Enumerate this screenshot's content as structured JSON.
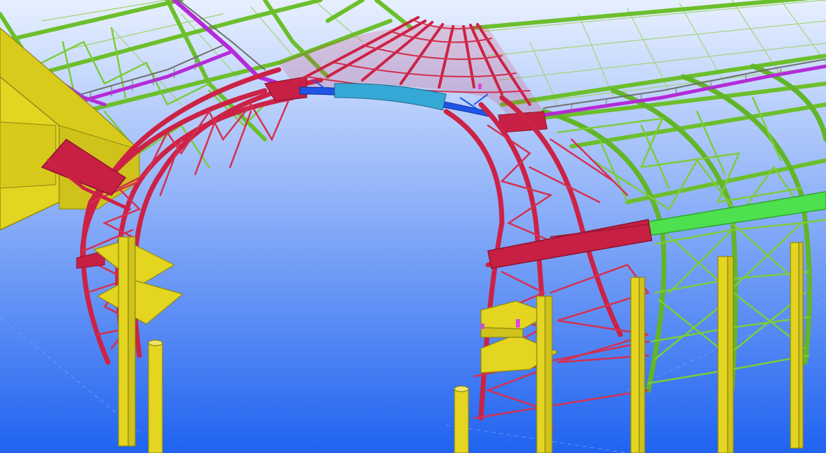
{
  "app": {},
  "viewport": {
    "background_top": "#e8f0ff",
    "background_bottom": "#1f63f0"
  },
  "colors": {
    "roof_green": "#73c634",
    "arch_red": "#cc2246",
    "column_yellow": "#e3d520",
    "walkway_magenta": "#b52ad9",
    "arch_blue": "#1f55e6",
    "arch_cyan": "#35a9d6",
    "beam_lightgreen": "#4ee04e",
    "rail_grey": "#6f6f6f"
  },
  "model": {
    "members": [
      "roof-truss-grid",
      "red-arch-left",
      "red-arch-right",
      "crown-ring",
      "yellow-columns",
      "yellow-platforms",
      "catwalks"
    ]
  }
}
